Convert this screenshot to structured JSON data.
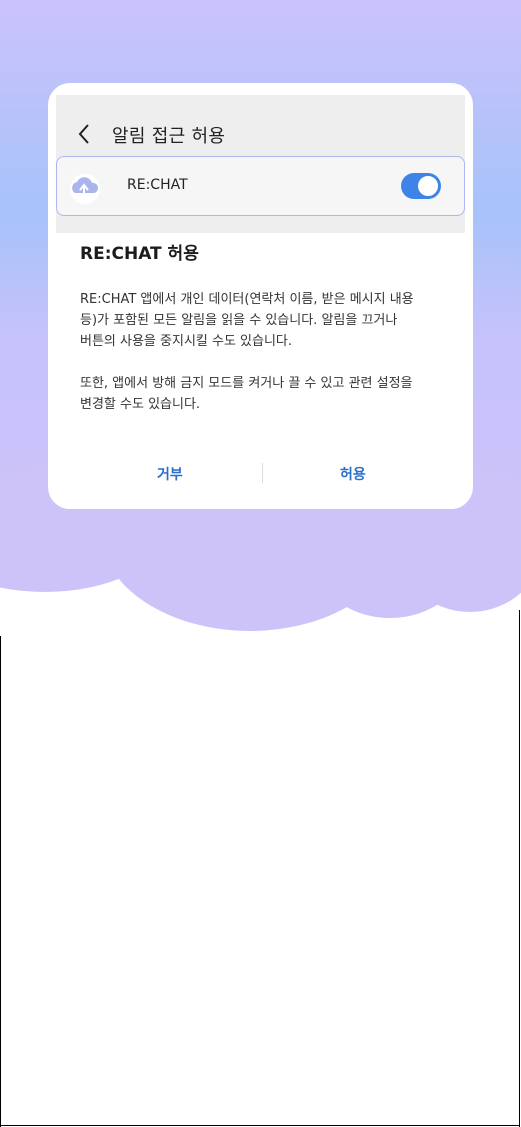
{
  "colors": {
    "background_top": "#c7c2fb",
    "background_mid": "#aac0f9",
    "cloud": "#cdc3f9",
    "accent_blue": "#3e84e8",
    "button_text": "#2a6fc9"
  },
  "header": {
    "back_icon": "chevron-left-icon",
    "title": "알림 접근 허용"
  },
  "app_entry": {
    "icon": "cloud-upload-icon",
    "name": "RE:CHAT",
    "toggle_on": true
  },
  "dialog": {
    "title": "RE:CHAT 허용",
    "body_lines_1": [
      "RE:CHAT 앱에서 개인 데이터(연락처 이름, 받은 메시지 내용",
      "등)가 포함된 모든 알림을 읽을 수 있습니다. 알림을 끄거나",
      "버튼의 사용을 중지시킬 수도 있습니다."
    ],
    "body_lines_2": [
      "또한, 앱에서 방해 금지 모드를 켜거나 끌 수 있고 관련 설정을",
      "변경할 수도 있습니다."
    ],
    "deny_label": "거부",
    "allow_label": "허용"
  }
}
